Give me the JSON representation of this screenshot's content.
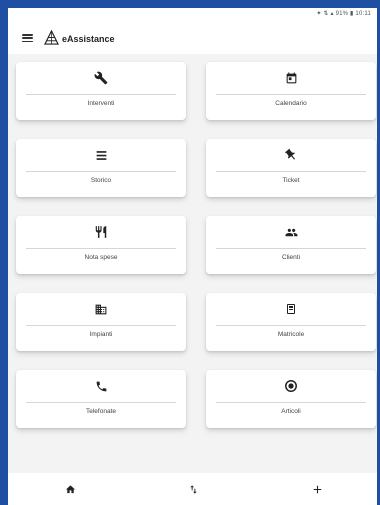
{
  "status_bar": {
    "text": "✦ ⇅ ▴ 91% ▮ 10:11"
  },
  "app_bar": {
    "title": "eAssistance",
    "menu_icon": "hamburger-menu-icon",
    "logo_icon": "pyramid-logo-icon"
  },
  "colors": {
    "frame_blue": "#1e4fa3",
    "icon_dark": "#222222",
    "card_bg": "#ffffff",
    "page_bg": "#f3f3f3"
  },
  "tiles": [
    {
      "label": "Interventi",
      "icon": "wrench-icon"
    },
    {
      "label": "Calendario",
      "icon": "calendar-icon"
    },
    {
      "label": "Storico",
      "icon": "list-icon"
    },
    {
      "label": "Ticket",
      "icon": "pushpin-icon"
    },
    {
      "label": "Nota spese",
      "icon": "restaurant-icon"
    },
    {
      "label": "Clienti",
      "icon": "people-icon"
    },
    {
      "label": "Impianti",
      "icon": "building-icon"
    },
    {
      "label": "Matricole",
      "icon": "document-icon"
    },
    {
      "label": "Telefonate",
      "icon": "phone-icon"
    },
    {
      "label": "Articoli",
      "icon": "target-icon"
    }
  ],
  "bottom_nav": [
    {
      "icon": "home-icon"
    },
    {
      "icon": "sync-arrows-icon"
    },
    {
      "icon": "plus-icon"
    }
  ]
}
